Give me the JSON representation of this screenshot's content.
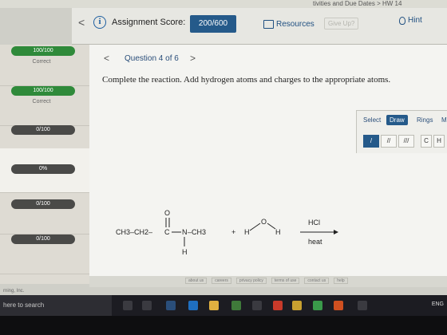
{
  "breadcrumb": "tivities and Due Dates",
  "breadcrumb_sep": ">",
  "breadcrumb_current": "HW 14",
  "header": {
    "prev_arrow": "<",
    "info_icon": "i",
    "score_label": "Assignment Score:",
    "score_value": "200/600",
    "resources": "Resources",
    "give_up": "Give Up?",
    "hint": "Hint"
  },
  "sidebar": {
    "items": [
      {
        "score": "100/100",
        "status": "Correct",
        "state": "correct"
      },
      {
        "score": "100/100",
        "status": "Correct",
        "state": "correct"
      },
      {
        "score": "0/100",
        "status": "",
        "state": "pending"
      },
      {
        "score": "0%",
        "status": "",
        "state": "current"
      },
      {
        "score": "0/100",
        "status": "",
        "state": "pending"
      },
      {
        "score": "0/100",
        "status": "",
        "state": "pending"
      }
    ]
  },
  "question": {
    "prev": "<",
    "title": "Question 4 of 6",
    "next": ">",
    "text": "Complete the reaction. Add hydrogen atoms and charges to the appropriate atoms."
  },
  "tools": {
    "tabs": [
      "Select",
      "Draw",
      "Rings",
      "M"
    ],
    "active_tab": "Draw",
    "bond_buttons": [
      "/",
      "//",
      "///"
    ],
    "atom_buttons": [
      "C",
      "H"
    ]
  },
  "reaction": {
    "reactant": {
      "left": "CH3–CH2–",
      "carbonyl_o": "O",
      "carbonyl_c": "C",
      "nitrogen": "N",
      "methyl": "–CH3",
      "n_h": "H"
    },
    "plus": "+",
    "water_h_left": "H",
    "water_o": "O",
    "water_h_right": "H",
    "reagent": "HCl",
    "condition": "heat"
  },
  "footer": {
    "links": [
      "about us",
      "careers",
      "privacy policy",
      "terms of use",
      "contact us",
      "help"
    ],
    "copyright": "rning, Inc."
  },
  "taskbar": {
    "search": "here to search",
    "tray": "ENG"
  },
  "colors": {
    "accent": "#255a8a",
    "correct": "#2f8a3a",
    "pending": "#4a4a48",
    "link": "#1f4f80"
  }
}
